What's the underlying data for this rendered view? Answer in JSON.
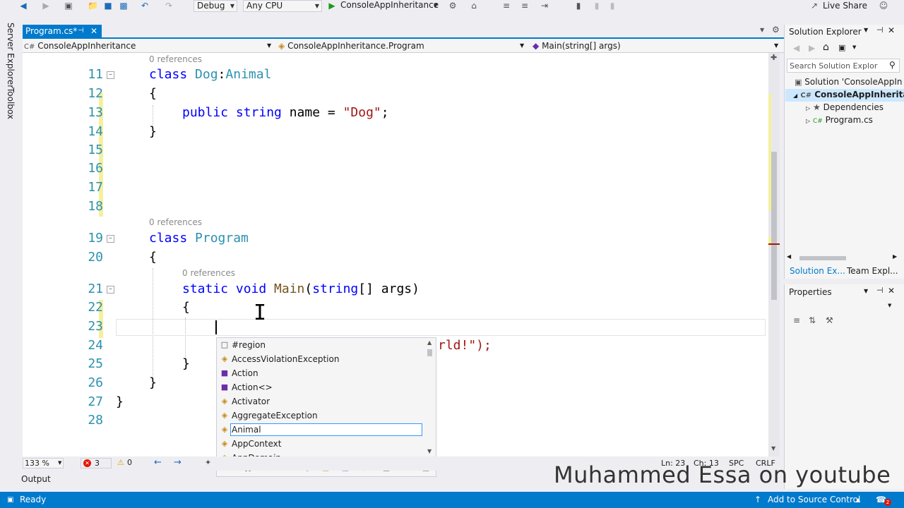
{
  "toolbar": {
    "config": "Debug",
    "platform": "Any CPU",
    "run_target": "ConsoleAppInheritance",
    "live_share": "Live Share"
  },
  "left_strip": {
    "server_explorer": "Server Explorer",
    "toolbox": "Toolbox"
  },
  "tab": {
    "title": "Program.cs*"
  },
  "navbar": {
    "project": "ConsoleAppInheritance",
    "class": "ConsoleAppInheritance.Program",
    "member": "Main(string[] args)"
  },
  "editor": {
    "refs_label": "0 references",
    "line_numbers": [
      "11",
      "12",
      "13",
      "14",
      "15",
      "16",
      "17",
      "18",
      "19",
      "20",
      "21",
      "22",
      "23",
      "24",
      "25",
      "26",
      "27",
      "28"
    ],
    "code": {
      "l11_kw": "class ",
      "l11_name": "Dog",
      "l11_colon": ":",
      "l11_base": "Animal",
      "l12": "{",
      "l13_kw1": "public ",
      "l13_kw2": "string ",
      "l13_name": "name = ",
      "l13_str": "\"Dog\"",
      "l13_end": ";",
      "l14": "}",
      "l19_kw": "class ",
      "l19_name": "Program",
      "l20": "{",
      "l21_kw1": "static ",
      "l21_kw2": "void ",
      "l21_meth": "Main",
      "l21_paren": "(",
      "l21_kw3": "string",
      "l21_rest": "[] args)",
      "l22": "{",
      "l24_tail": "rld!\");",
      "l25": "}",
      "l26": "}",
      "l27": "}"
    }
  },
  "completion": {
    "items": [
      {
        "label": "#region",
        "icon": "snippet-icon"
      },
      {
        "label": "AccessViolationException",
        "icon": "class-icon"
      },
      {
        "label": "Action",
        "icon": "delegate-icon"
      },
      {
        "label": "Action<>",
        "icon": "delegate-icon"
      },
      {
        "label": "Activator",
        "icon": "class-icon"
      },
      {
        "label": "AggregateException",
        "icon": "class-icon"
      },
      {
        "label": "Animal",
        "icon": "class-icon"
      },
      {
        "label": "AppContext",
        "icon": "class-icon"
      },
      {
        "label": "AppDomain",
        "icon": "class-icon"
      }
    ],
    "selected": "Animal"
  },
  "editor_status": {
    "zoom": "133 %",
    "errors": "3",
    "warnings": "0",
    "line": "Ln: 23",
    "col": "Ch: 13",
    "spc": "SPC",
    "crlf": "CRLF"
  },
  "output_label": "Output",
  "status": {
    "ready": "Ready",
    "source_control": "Add to Source Control",
    "notifications": "2"
  },
  "solution_explorer": {
    "title": "Solution Explorer",
    "search_placeholder": "Search Solution Explor",
    "solution": "Solution 'ConsoleAppIn",
    "project": "ConsoleAppInherita",
    "dependencies": "Dependencies",
    "file": "Program.cs",
    "tab1": "Solution Ex...",
    "tab2": "Team Expl..."
  },
  "properties": {
    "title": "Properties"
  },
  "watermark": "Muhammed Essa on youtube",
  "colors": {
    "accent": "#007acc",
    "keyword": "#0000ff",
    "type": "#2b91af",
    "string": "#a31515"
  }
}
